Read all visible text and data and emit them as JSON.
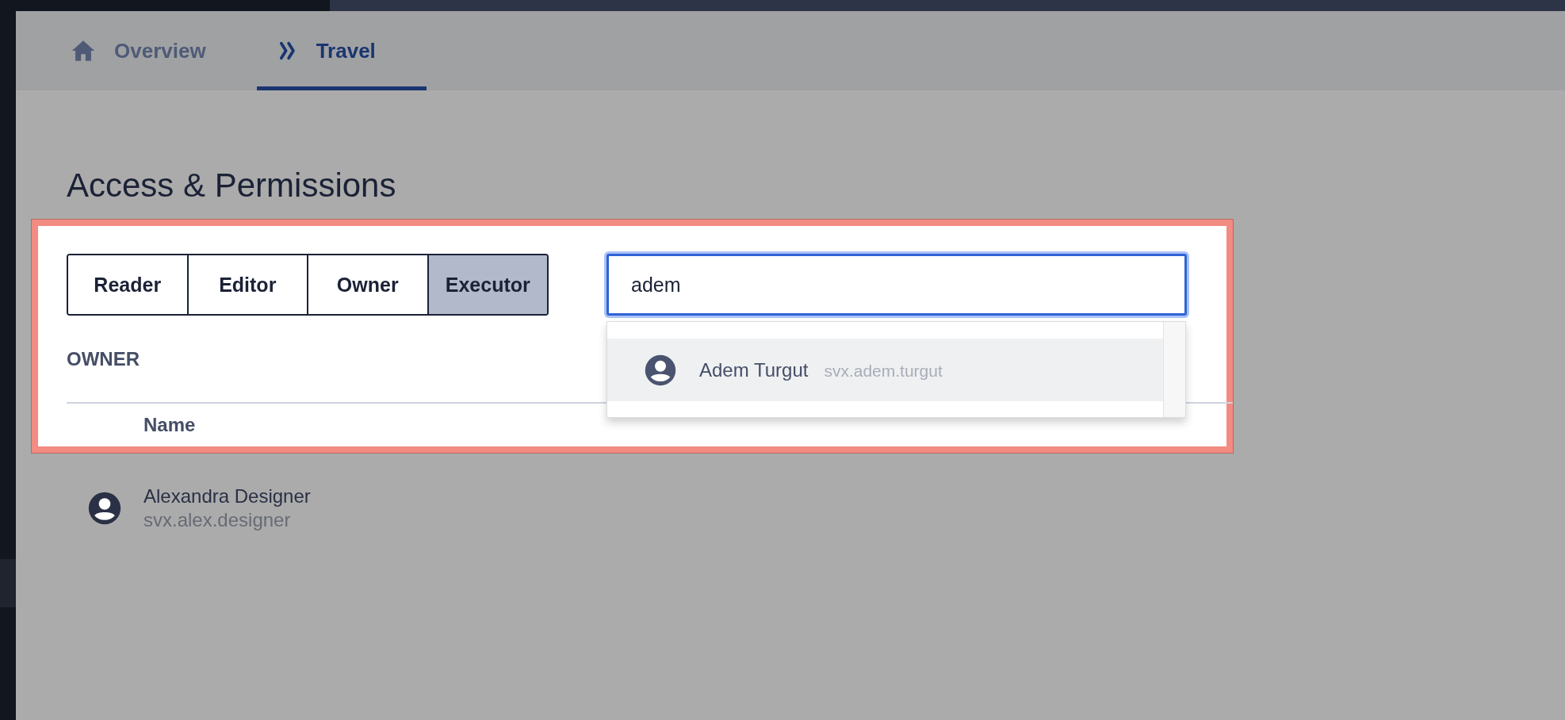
{
  "tabs": [
    {
      "label": "Overview",
      "kind": "home",
      "selected": false
    },
    {
      "label": "Travel",
      "kind": "forward",
      "selected": true
    }
  ],
  "title": "Access & Permissions",
  "roles": [
    {
      "label": "Reader",
      "selected": false
    },
    {
      "label": "Editor",
      "selected": false
    },
    {
      "label": "Owner",
      "selected": false
    },
    {
      "label": "Executor",
      "selected": true
    }
  ],
  "search": {
    "value": "adem"
  },
  "suggestions": [
    {
      "name": "Adem Turgut",
      "username": "svx.adem.turgut",
      "selected": true
    }
  ],
  "section": "OWNER",
  "table": {
    "columns": [
      "Name"
    ],
    "rows": [
      {
        "name": "Alexandra Designer",
        "username": "svx.alex.designer"
      }
    ]
  }
}
